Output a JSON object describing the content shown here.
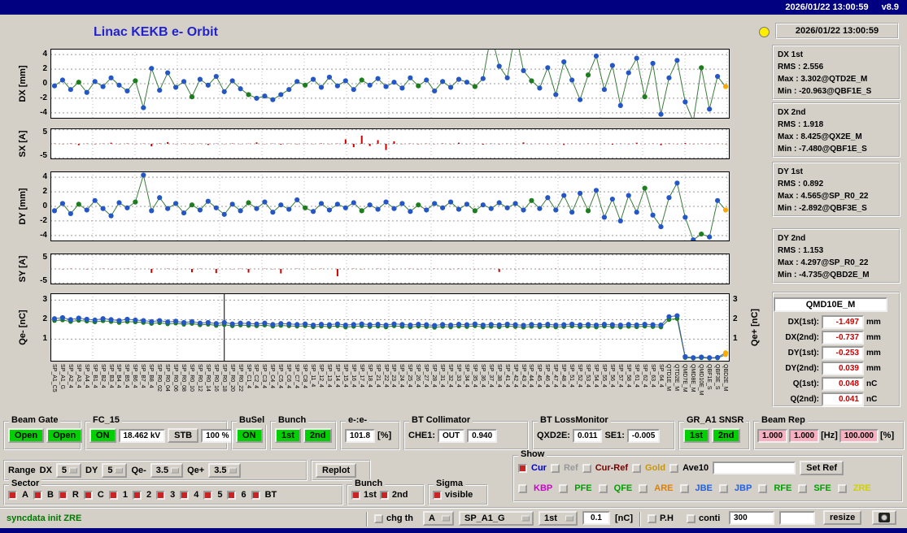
{
  "titlebar": {
    "datetime": "2026/01/22 13:00:59",
    "version": "v8.9"
  },
  "header": {
    "title": "Linac KEKB e- Orbit",
    "timestamp": "2026/01/22 13:00:59"
  },
  "colors": {
    "title_blue": "#2222cc",
    "status_green": "#007700",
    "value_red": "#cc0000",
    "dot_blue": "#2457c5",
    "dot_green": "#1e7d1e",
    "dot_orange": "#ffaa00",
    "bar_red": "#cc0000",
    "accent_green": "#00d000",
    "pink": "#f8b0c0",
    "lamp_yellow": "#ffee00",
    "topbar_navy": "#000080"
  },
  "stats_boxes": [
    {
      "title": "DX 1st",
      "lines": [
        "RMS : 2.556",
        "Max : 3.302@QTD2E_M",
        "Min : -20.963@QBF1E_S"
      ]
    },
    {
      "title": "DX 2nd",
      "lines": [
        "RMS : 1.918",
        "Max : 8.425@QX2E_M",
        "Min : -7.480@QBF1E_S"
      ]
    },
    {
      "title": "DY 1st",
      "lines": [
        "RMS : 0.892",
        "Max : 4.565@SP_R0_22",
        "Min : -2.892@QBF3E_S"
      ]
    },
    {
      "title": "DY 2nd",
      "lines": [
        "RMS : 1.153",
        "Max : 4.297@SP_R0_22",
        "Min : -4.735@QBD2E_M"
      ]
    }
  ],
  "qmd": {
    "title": "QMD10E_M",
    "rows": [
      {
        "label": "DX(1st):",
        "value": "-1.497",
        "unit": "mm"
      },
      {
        "label": "DX(2nd):",
        "value": "-0.737",
        "unit": "mm"
      },
      {
        "label": "DY(1st):",
        "value": "-0.253",
        "unit": "mm"
      },
      {
        "label": "DY(2nd):",
        "value": "0.039",
        "unit": "mm"
      },
      {
        "label": "Q(1st):",
        "value": "0.048",
        "unit": "nC"
      },
      {
        "label": "Q(2nd):",
        "value": "0.041",
        "unit": "nC"
      }
    ]
  },
  "plots": {
    "dx": {
      "type": "scatter",
      "axis_label": "DX [mm]",
      "ylim": [
        -4.8,
        4.8
      ],
      "yticks": [
        4,
        2,
        0,
        -2,
        -4
      ],
      "points": [
        -0.3,
        0.5,
        -0.8,
        0.2,
        -1.2,
        0.3,
        -0.4,
        0.8,
        -0.2,
        -1.0,
        0.4,
        -3.3,
        2.1,
        -0.9,
        1.5,
        -0.5,
        0.3,
        -1.8,
        0.6,
        -0.2,
        1.0,
        -1.1,
        0.4,
        -0.7,
        -1.5,
        -2.0,
        -1.7,
        -2.2,
        -1.5,
        -0.8,
        0.3,
        -0.2,
        0.6,
        -0.5,
        0.9,
        -0.3,
        0.4,
        -0.8,
        0.5,
        -0.2,
        0.7,
        -0.4,
        0.2,
        -0.6,
        0.8,
        -0.3,
        0.5,
        -1.0,
        0.3,
        -0.5,
        0.6,
        0.2,
        -0.4,
        0.7,
        6.8,
        2.4,
        0.8,
        7.2,
        1.8,
        0.4,
        -0.6,
        2.2,
        -1.5,
        3.0,
        0.5,
        -2.2,
        1.2,
        3.8,
        -0.8,
        2.5,
        -3.0,
        1.5,
        3.5,
        -1.8,
        2.8,
        -4.2,
        0.8,
        3.2,
        -2.5,
        -5.2,
        2.2,
        -3.5,
        1.0,
        -0.4
      ]
    },
    "sx": {
      "type": "bars",
      "axis_label": "SX [A]",
      "ylim": [
        -5.5,
        5.5
      ],
      "yticks": [
        5,
        -5
      ],
      "values": [
        0.1,
        -0.1,
        0.15,
        -0.5,
        0.1,
        -0.15,
        0.1,
        0.4,
        -0.1,
        0.15,
        -0.1,
        0.1,
        -0.9,
        0.15,
        0.6,
        -0.1,
        0.1,
        -0.15,
        0.1,
        -0.4,
        0.1,
        -0.1,
        0.15,
        -0.1,
        0.1,
        0.5,
        -0.1,
        0.1,
        -0.3,
        0.1,
        -0.15,
        0.1,
        -0.1,
        0.15,
        -0.1,
        0.1,
        1.6,
        -1.2,
        2.9,
        -0.8,
        1.3,
        -2.2,
        0.9,
        -0.1,
        0.1,
        -0.15,
        0.1,
        -0.1,
        0.15,
        -0.1,
        0.4,
        -0.1,
        0.1,
        -0.3,
        0.1,
        -0.15,
        0.1,
        -0.1,
        0.5,
        -0.1,
        0.1,
        -0.15,
        0.1,
        -0.4,
        0.1,
        -0.1,
        0.15,
        -0.1,
        0.1,
        -0.3,
        0.1,
        -0.15,
        0.4,
        -0.1,
        0.1,
        -0.5,
        0.15,
        -0.1,
        0.3,
        -0.1,
        0.1,
        -0.15,
        0.1,
        -0.1
      ]
    },
    "dy": {
      "type": "scatter",
      "axis_label": "DY [mm]",
      "ylim": [
        -4.8,
        4.8
      ],
      "yticks": [
        4,
        2,
        0,
        -2,
        -4
      ],
      "points": [
        -0.6,
        0.4,
        -1.0,
        0.3,
        -0.5,
        0.8,
        -0.3,
        -1.3,
        0.5,
        -0.2,
        0.6,
        4.3,
        -0.6,
        1.2,
        -0.3,
        0.4,
        -0.9,
        0.2,
        -0.5,
        0.7,
        -0.2,
        -1.1,
        0.3,
        -0.6,
        0.5,
        -0.3,
        0.6,
        -0.8,
        0.2,
        -0.4,
        0.9,
        -0.2,
        -0.7,
        0.4,
        -0.5,
        0.3,
        -0.2,
        0.5,
        -0.6,
        0.2,
        -0.4,
        0.6,
        -0.3,
        0.4,
        -0.7,
        0.2,
        -0.5,
        0.4,
        -0.2,
        0.6,
        -0.4,
        0.3,
        -0.6,
        0.2,
        -0.3,
        0.5,
        -0.2,
        0.4,
        -0.5,
        0.8,
        -0.3,
        1.2,
        -0.5,
        1.5,
        -0.8,
        1.8,
        -0.6,
        2.2,
        -1.5,
        1.0,
        -2.0,
        1.5,
        -0.8,
        2.5,
        -1.2,
        -2.8,
        1.2,
        3.2,
        -1.5,
        -4.6,
        -3.8,
        -4.2,
        0.8,
        -0.5
      ]
    },
    "sy": {
      "type": "bars",
      "axis_label": "SY [A]",
      "ylim": [
        -5.5,
        5.5
      ],
      "yticks": [
        5,
        -5
      ],
      "values": [
        0,
        -0.1,
        0.1,
        0,
        -0.15,
        0,
        0.1,
        -0.1,
        0,
        0.1,
        -0.1,
        0,
        -1.4,
        0,
        0.1,
        -0.1,
        0,
        -1.2,
        0.1,
        0,
        -1.5,
        0,
        -0.1,
        0.1,
        -1.3,
        0,
        0.1,
        -0.1,
        -1.6,
        0,
        0.1,
        0,
        -0.1,
        0.1,
        0,
        -2.6,
        0,
        0.1,
        -0.1,
        0,
        0.1,
        0,
        -0.1,
        0,
        0.1,
        -0.1,
        0,
        0.1,
        0,
        -0.1,
        0.1,
        0,
        -0.1,
        0,
        0.1,
        -1.1,
        0,
        -0.1,
        0.1,
        0,
        -0.1,
        0,
        0.1,
        -0.1,
        0,
        0.1,
        0,
        -0.1,
        0.1,
        0,
        -0.1,
        0.1,
        0,
        -0.1,
        0,
        0.1,
        -0.1,
        0,
        0.1,
        -0.1,
        0,
        0.1,
        -0.1,
        0
      ]
    },
    "q": {
      "type": "scatter2",
      "axis_label": "Qe- [nC]",
      "axis_label_right": "Qe+ [nC]",
      "ylim": [
        -0.15,
        3.35
      ],
      "yticks": [
        3,
        2,
        1
      ],
      "yticks_right": [
        3,
        2,
        1
      ],
      "vline_index": 21,
      "series1": [
        2.05,
        2.1,
        2.0,
        2.08,
        2.02,
        1.98,
        2.05,
        2.0,
        1.95,
        2.02,
        1.98,
        1.95,
        1.9,
        1.95,
        1.88,
        1.92,
        1.85,
        1.9,
        1.82,
        1.85,
        1.8,
        1.85,
        1.78,
        1.82,
        1.8,
        1.78,
        1.82,
        1.75,
        1.8,
        1.78,
        1.75,
        1.78,
        1.72,
        1.76,
        1.74,
        1.78,
        1.72,
        1.75,
        1.78,
        1.74,
        1.76,
        1.72,
        1.78,
        1.75,
        1.72,
        1.76,
        1.74,
        1.7,
        1.75,
        1.72,
        1.76,
        1.74,
        1.78,
        1.72,
        1.75,
        1.73,
        1.77,
        1.74,
        1.71,
        1.75,
        1.73,
        1.76,
        1.72,
        1.74,
        1.77,
        1.73,
        1.75,
        1.72,
        1.76,
        1.74,
        1.72,
        1.75,
        1.73,
        1.76,
        1.74,
        1.72,
        2.15,
        2.2,
        0.1,
        0.05,
        0.08,
        0.05,
        0.06,
        0.3
      ],
      "series2": [
        1.95,
        1.98,
        1.9,
        1.96,
        1.92,
        1.88,
        1.94,
        1.9,
        1.85,
        1.9,
        1.88,
        1.85,
        1.8,
        1.84,
        1.78,
        1.82,
        1.76,
        1.8,
        1.73,
        1.76,
        1.7,
        1.74,
        1.68,
        1.72,
        1.7,
        1.68,
        1.72,
        1.66,
        1.7,
        1.68,
        1.66,
        1.68,
        1.63,
        1.66,
        1.64,
        1.68,
        1.62,
        1.65,
        1.68,
        1.64,
        1.66,
        1.62,
        1.68,
        1.65,
        1.62,
        1.66,
        1.64,
        1.6,
        1.65,
        1.62,
        1.66,
        1.64,
        1.68,
        1.62,
        1.65,
        1.63,
        1.67,
        1.64,
        1.61,
        1.65,
        1.63,
        1.66,
        1.62,
        1.64,
        1.67,
        1.63,
        1.65,
        1.62,
        1.66,
        1.64,
        1.62,
        1.65,
        1.63,
        1.66,
        1.64,
        1.62,
        2.0,
        2.05,
        0.05,
        0.02,
        0.04,
        0.02,
        0.03,
        0.2
      ]
    },
    "xlabels": [
      "SP_A1_C5",
      "SP_A1_G",
      "SP_A2_4",
      "SP_A3_4",
      "SP_A4_4",
      "SP_B1_4",
      "SP_B2_4",
      "SP_B3_4",
      "SP_B4_4",
      "SP_B5_4",
      "SP_B6_4",
      "SP_B7_4",
      "SP_B8_4",
      "SP_R0_02",
      "SP_R0_04",
      "SP_R0_06",
      "SP_R0_08",
      "SP_R0_10",
      "SP_R0_12",
      "SP_R0_14",
      "SP_R0_16",
      "SP_R0_18",
      "SP_R0_20",
      "SP_R0_22",
      "SP_C1_4",
      "SP_C2_4",
      "SP_C3_4",
      "SP_C4_4",
      "SP_C5_4",
      "SP_C6_4",
      "SP_C7_4",
      "SP_C8_4",
      "SP_11_4",
      "SP_12_4",
      "SP_13_4",
      "SP_14_4",
      "SP_15_4",
      "SP_16_4",
      "SP_17_4",
      "SP_18_4",
      "SP_21_4",
      "SP_22_4",
      "SP_23_4",
      "SP_24_4",
      "SP_25_4",
      "SP_26_4",
      "SP_27_4",
      "SP_28_4",
      "SP_31_4",
      "SP_32_4",
      "SP_33_4",
      "SP_34_4",
      "SP_35_4",
      "SP_36_4",
      "SP_37_4",
      "SP_38_4",
      "SP_41_4",
      "SP_42_4",
      "SP_43_4",
      "SP_44_4",
      "SP_45_4",
      "SP_46_4",
      "SP_47_4",
      "SP_48_4",
      "SP_51_4",
      "SP_52_4",
      "SP_53_4",
      "SP_54_4",
      "SP_55_4",
      "SP_56_4",
      "SP_57_4",
      "SP_58_4",
      "SP_61_4",
      "SP_62_4",
      "SP_63_4",
      "SP_64_4",
      "QTD1E_M",
      "QTD2E_M",
      "QMD7E_M",
      "QMD8E_M",
      "QMD10E_M",
      "QBF1E_S",
      "QBF3E_S",
      "QBD2E_M"
    ]
  },
  "panels": {
    "beam_gate": {
      "title": "Beam Gate",
      "buttons": [
        "Open",
        "Open"
      ]
    },
    "fc15": {
      "title": "FC_15",
      "on": "ON",
      "kv": "18.462 kV",
      "stb": "STB",
      "pct": "100 %"
    },
    "busel": {
      "title": "BuSel",
      "on": "ON"
    },
    "bunch": {
      "title": "Bunch",
      "b1": "1st",
      "b2": "2nd"
    },
    "ee": {
      "title": "e-:e-",
      "value": "101.8",
      "unit": "[%]"
    },
    "bt_collimator": {
      "title": "BT Collimator",
      "che1_label": "CHE1:",
      "che1": "OUT",
      "value": "0.940"
    },
    "bt_lossmonitor": {
      "title": "BT LossMonitor",
      "qxd2e_label": "QXD2E:",
      "qxd2e": "0.011",
      "se1_label": "SE1:",
      "se1": "-0.005"
    },
    "gr_a1_snsr": {
      "title": "GR_A1 SNSR",
      "b1": "1st",
      "b2": "2nd"
    },
    "beam_rep": {
      "title": "Beam Rep",
      "v1": "1.000",
      "v2": "1.000",
      "hz": "[Hz]",
      "v3": "100.000",
      "pct": "[%]"
    },
    "range": {
      "title": "Range",
      "items": [
        {
          "label": "DX",
          "value": "5"
        },
        {
          "label": "DY",
          "value": "5"
        },
        {
          "label": "Qe-",
          "value": "3.5"
        },
        {
          "label": "Qe+",
          "value": "3.5"
        }
      ],
      "replot": "Replot"
    },
    "sector": {
      "title": "Sector",
      "items": [
        {
          "label": "A",
          "checked": true
        },
        {
          "label": "B",
          "checked": true
        },
        {
          "label": "R",
          "checked": true
        },
        {
          "label": "C",
          "checked": true
        },
        {
          "label": "1",
          "checked": true
        },
        {
          "label": "2",
          "checked": true
        },
        {
          "label": "3",
          "checked": true
        },
        {
          "label": "4",
          "checked": true
        },
        {
          "label": "5",
          "checked": true
        },
        {
          "label": "6",
          "checked": true
        },
        {
          "label": "BT",
          "checked": true
        }
      ]
    },
    "bunch2": {
      "title": "Bunch",
      "items": [
        {
          "label": "1st",
          "checked": true
        },
        {
          "label": "2nd",
          "checked": true
        }
      ]
    },
    "sigma": {
      "title": "Sigma",
      "item": {
        "label": "visible",
        "checked": true
      }
    },
    "show": {
      "title": "Show",
      "row1": [
        {
          "label": "Cur",
          "color": "#0000cc",
          "checked": true
        },
        {
          "label": "Ref",
          "color": "#999999",
          "checked": false
        },
        {
          "label": "Cur-Ref",
          "color": "#7a0000",
          "checked": false
        },
        {
          "label": "Gold",
          "color": "#c8960c",
          "checked": false
        },
        {
          "label": "Ave10",
          "color": "#000000",
          "checked": false
        }
      ],
      "input_value": "",
      "set_ref": "Set Ref",
      "row2": [
        {
          "label": "KBP",
          "color": "#d000d0",
          "checked": false
        },
        {
          "label": "PFE",
          "color": "#00a000",
          "checked": false
        },
        {
          "label": "QFE",
          "color": "#00a000",
          "checked": false
        },
        {
          "label": "ARE",
          "color": "#e08000",
          "checked": false
        },
        {
          "label": "JBE",
          "color": "#2060e0",
          "checked": false
        },
        {
          "label": "JBP",
          "color": "#2060e0",
          "checked": false
        },
        {
          "label": "RFE",
          "color": "#00a000",
          "checked": false
        },
        {
          "label": "SFE",
          "color": "#00a000",
          "checked": false
        },
        {
          "label": "ZRE",
          "color": "#d0d000",
          "checked": false
        }
      ]
    }
  },
  "statusbar": {
    "message": "syncdata init ZRE",
    "chg_th": {
      "label": "chg th",
      "checked": false
    },
    "dd1": "A",
    "dd2": "SP_A1_G",
    "dd3": "1st",
    "threshold": "0.1",
    "unit": "[nC]",
    "ph": {
      "label": "P.H",
      "checked": false
    },
    "conti": {
      "label": "conti",
      "checked": false
    },
    "val300": "300",
    "blank": "",
    "resize": "resize"
  }
}
